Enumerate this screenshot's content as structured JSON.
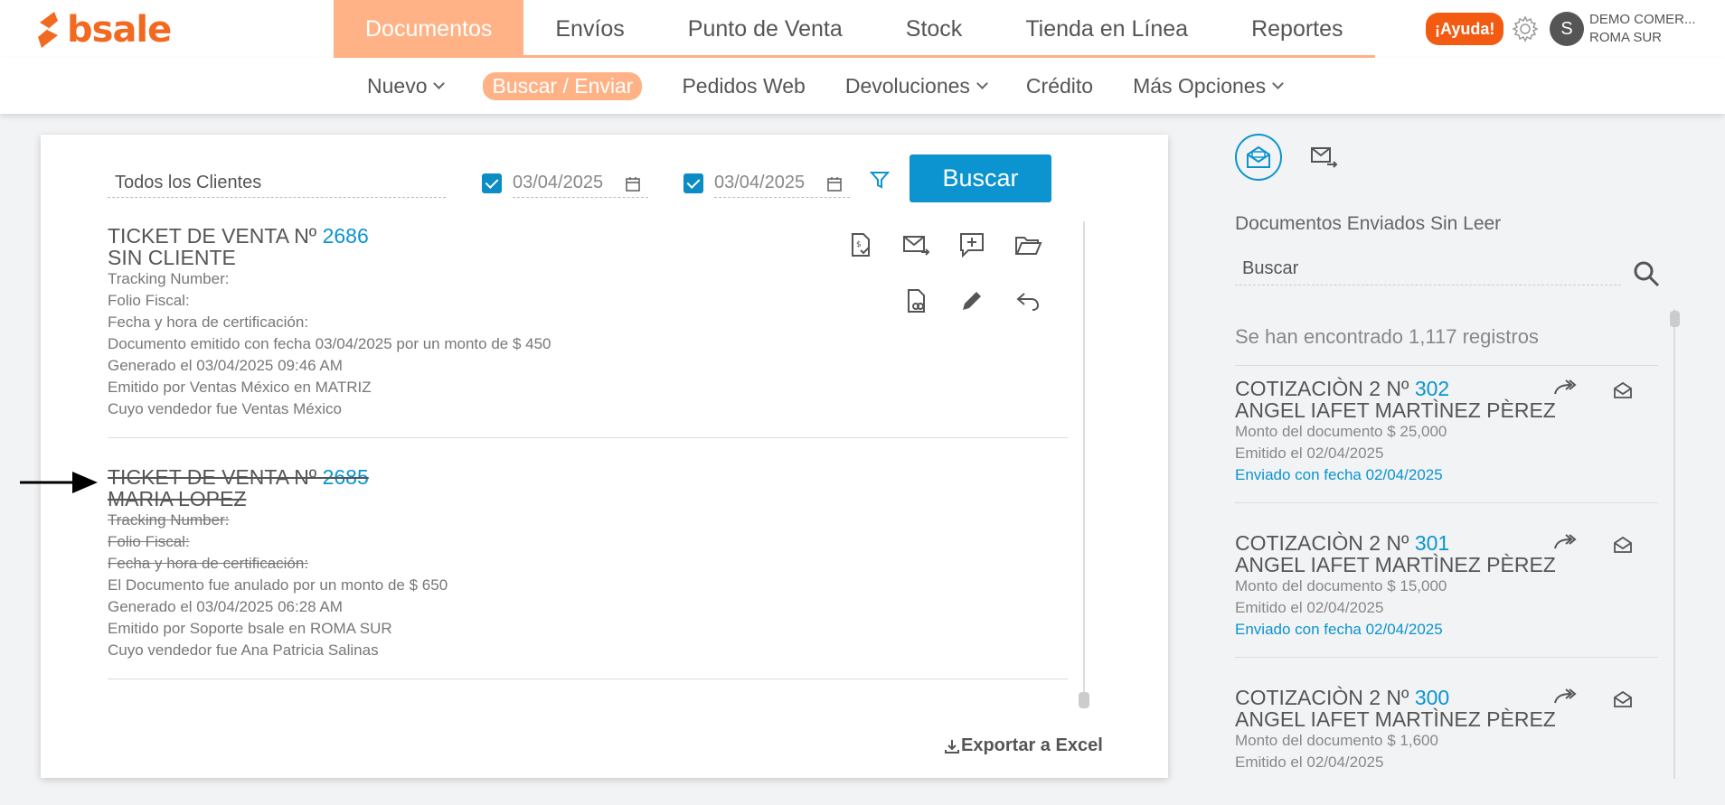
{
  "brand": {
    "name": "bsale",
    "color": "#f26a22"
  },
  "mainnav": [
    {
      "label": "Documentos"
    },
    {
      "label": "Envíos"
    },
    {
      "label": "Punto de Venta"
    },
    {
      "label": "Stock"
    },
    {
      "label": "Tienda en Línea"
    },
    {
      "label": "Reportes"
    }
  ],
  "header": {
    "help_label": "¡Ayuda!",
    "avatar_initial": "S",
    "company_line1": "DEMO COMER...",
    "company_line2": "ROMA SUR"
  },
  "subnav": [
    {
      "label": "Nuevo",
      "dropdown": true
    },
    {
      "label": "Buscar / Enviar",
      "active": true
    },
    {
      "label": "Pedidos Web"
    },
    {
      "label": "Devoluciones",
      "dropdown": true
    },
    {
      "label": "Crédito"
    },
    {
      "label": "Más Opciones",
      "dropdown": true
    }
  ],
  "filters": {
    "client": "Todos los Clientes",
    "date_from": "03/04/2025",
    "date_to": "03/04/2025",
    "search_button": "Buscar"
  },
  "documents": [
    {
      "title_prefix": "TICKET DE VENTA Nº",
      "number": "2686",
      "client": "SIN CLIENTE",
      "tracking": "Tracking Number:",
      "folio": "Folio Fiscal:",
      "cert": "Fecha y hora de certificación:",
      "status": "Documento emitido con fecha 03/04/2025 por un monto de $ 450",
      "generated": "Generado el 03/04/2025 09:46 AM",
      "issued_by": "Emitido por Ventas México en MATRIZ",
      "seller": "Cuyo vendedor fue Ventas México"
    },
    {
      "title_prefix": "TICKET DE VENTA Nº",
      "number": "2685",
      "client": "MARIA LOPEZ",
      "tracking": "Tracking Number:",
      "folio": "Folio Fiscal:",
      "cert": "Fecha y hora de certificación:",
      "status": "El Documento fue anulado por un monto de $ 650",
      "generated": "Generado el 03/04/2025 06:28 AM",
      "issued_by": "Emitido por Soporte bsale en ROMA SUR",
      "seller": "Cuyo vendedor fue Ana Patricia Salinas"
    }
  ],
  "export_label": "Exportar a Excel",
  "right_panel": {
    "title": "Documentos Enviados Sin Leer",
    "search_placeholder": "Buscar",
    "found": "Se han encontrado 1,117 registros",
    "items": [
      {
        "prefix": "COTIZACIÒN 2 Nº",
        "number": "302",
        "client": "ANGEL IAFET MARTÌNEZ PÈREZ",
        "amount": "Monto del documento $ 25,000",
        "issued": "Emitido el 02/04/2025",
        "sent": "Enviado con fecha 02/04/2025"
      },
      {
        "prefix": "COTIZACIÒN 2 Nº",
        "number": "301",
        "client": "ANGEL IAFET MARTÌNEZ PÈREZ",
        "amount": "Monto del documento $ 15,000",
        "issued": "Emitido el 02/04/2025",
        "sent": "Enviado con fecha 02/04/2025"
      },
      {
        "prefix": "COTIZACIÒN 2 Nº",
        "number": "300",
        "client": "ANGEL IAFET MARTÌNEZ PÈREZ",
        "amount": "Monto del documento $ 1,600",
        "issued": "Emitido el 02/04/2025"
      }
    ]
  },
  "icons": {
    "doc_actions_row1": [
      "receipt-check-icon",
      "email-forward-icon",
      "comment-add-icon",
      "folder-open-icon"
    ],
    "doc_actions_row2": [
      "file-link-icon",
      "pencil-icon",
      "undo-icon"
    ]
  },
  "colors": {
    "accent": "#0b94cf",
    "nav_active": "#ffb286",
    "help": "#f45b12"
  }
}
